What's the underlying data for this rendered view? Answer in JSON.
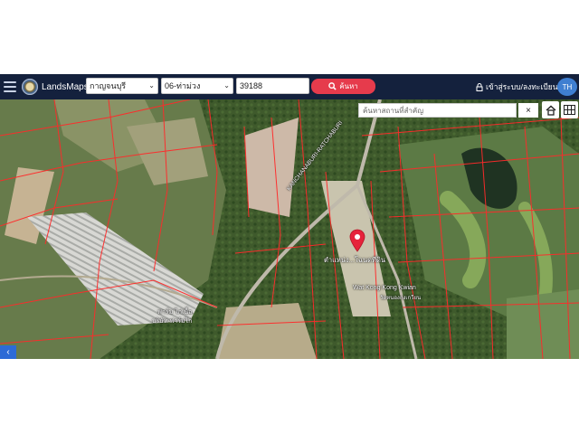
{
  "header": {
    "brand": "LandsMaps",
    "province": "กาญจนบุรี",
    "district": "06-ท่าม่วง",
    "parcel_number": "39188",
    "search_label": "ค้นหา",
    "login_label": "เข้าสู่ระบบ/ลงทะเบียน",
    "language": "TH"
  },
  "map": {
    "place_search_placeholder": "ค้นหาสถานที่สำคัญ",
    "close_label": "×",
    "labels": {
      "road": "KANCHANABURI-RATCHABURI",
      "location": "ตำแหน่ง...โฉนดที่ดิน",
      "temple": "Wat Kong Kong Kwian",
      "temple_sub": "วัดหนองกงเกวียน",
      "factory": "ฟาร์ม ไก่เนื้อ",
      "factory_sub": "บริษัท ฟาร์มไก่"
    },
    "icons": {
      "home": "home-icon",
      "grid": "grid-icon",
      "pin": "location-pin-icon",
      "corner": "collapse-icon"
    },
    "colors": {
      "header_bg": "#14213d",
      "search_button": "#e63b4c",
      "parcel_lines": "#ff2a2a",
      "pin": "#e6233b",
      "avatar": "#3f7fd1"
    }
  }
}
